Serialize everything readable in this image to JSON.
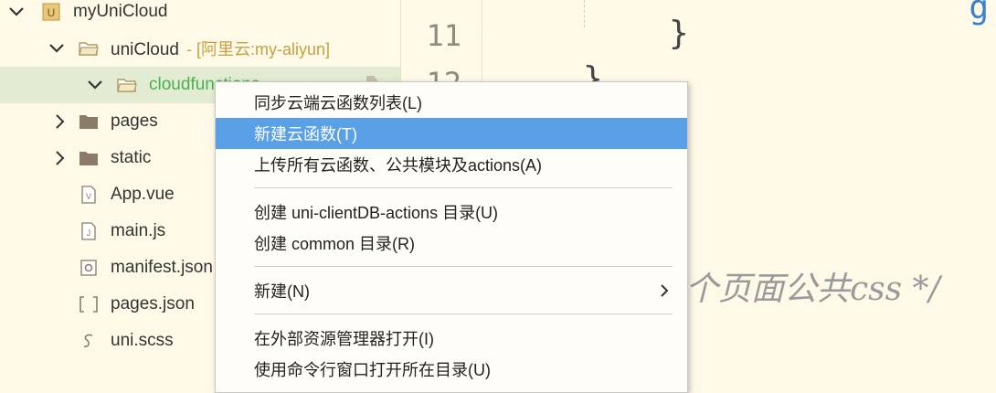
{
  "tree": {
    "root": {
      "label": "myUniCloud",
      "icon": "project-icon"
    },
    "unicloud": {
      "label": "uniCloud",
      "sub": "- [阿里云:my-aliyun]"
    },
    "cloudfunctions": {
      "label": "cloudfunctions"
    },
    "items": [
      {
        "label": "pages",
        "icon": "folder-icon"
      },
      {
        "label": "static",
        "icon": "folder-icon"
      },
      {
        "label": "App.vue",
        "icon": "vue-file-icon"
      },
      {
        "label": "main.js",
        "icon": "js-file-icon"
      },
      {
        "label": "manifest.json",
        "icon": "manifest-file-icon"
      },
      {
        "label": "pages.json",
        "icon": "json-file-icon"
      },
      {
        "label": "uni.scss",
        "icon": "scss-file-icon"
      }
    ]
  },
  "gutter": {
    "line11": "11",
    "line12": "12"
  },
  "editor": {
    "brace1": "}",
    "brace2": "}",
    "comment": "个页面公共css */"
  },
  "menu": {
    "items": [
      "同步云端云函数列表(L)",
      "新建云函数(T)",
      "上传所有云函数、公共模块及actions(A)",
      "创建 uni-clientDB-actions 目录(U)",
      "创建 common 目录(R)",
      "新建(N)",
      "在外部资源管理器打开(I)",
      "使用命令行窗口打开所在目录(U)"
    ]
  },
  "colors": {
    "highlight": "#5aa0e6",
    "selected_row": "#e1ecd3",
    "background": "#fffae8",
    "cloud_text": "#4caf50"
  }
}
